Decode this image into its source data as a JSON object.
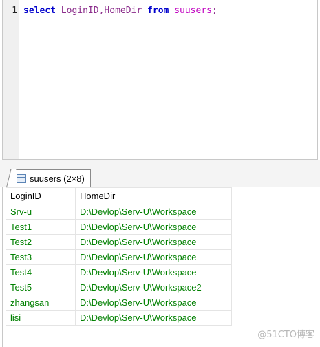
{
  "editor": {
    "line_number": "1",
    "tokens": {
      "select": "select",
      "col1": "LoginID",
      "comma": ",",
      "col2": "HomeDir",
      "from": "from",
      "table": "suusers",
      "semi": ";"
    }
  },
  "result_tab": {
    "label": "suusers (2×8)",
    "icon": "table-icon"
  },
  "grid": {
    "columns": [
      "LoginID",
      "HomeDir"
    ],
    "rows": [
      [
        "Srv-u",
        "D:\\Devlop\\Serv-U\\Workspace"
      ],
      [
        "Test1",
        "D:\\Devlop\\Serv-U\\Workspace"
      ],
      [
        "Test2",
        "D:\\Devlop\\Serv-U\\Workspace"
      ],
      [
        "Test3",
        "D:\\Devlop\\Serv-U\\Workspace"
      ],
      [
        "Test4",
        "D:\\Devlop\\Serv-U\\Workspace"
      ],
      [
        "Test5",
        "D:\\Devlop\\Serv-U\\Workspace2"
      ],
      [
        "zhangsan",
        "D:\\Devlop\\Serv-U\\Workspace"
      ],
      [
        "lisi",
        "D:\\Devlop\\Serv-U\\Workspace"
      ]
    ]
  },
  "watermark": "@51CTO博客",
  "colors": {
    "keyword": "#0000cc",
    "identifier": "#8a2b8a",
    "cell_text": "#008000"
  }
}
